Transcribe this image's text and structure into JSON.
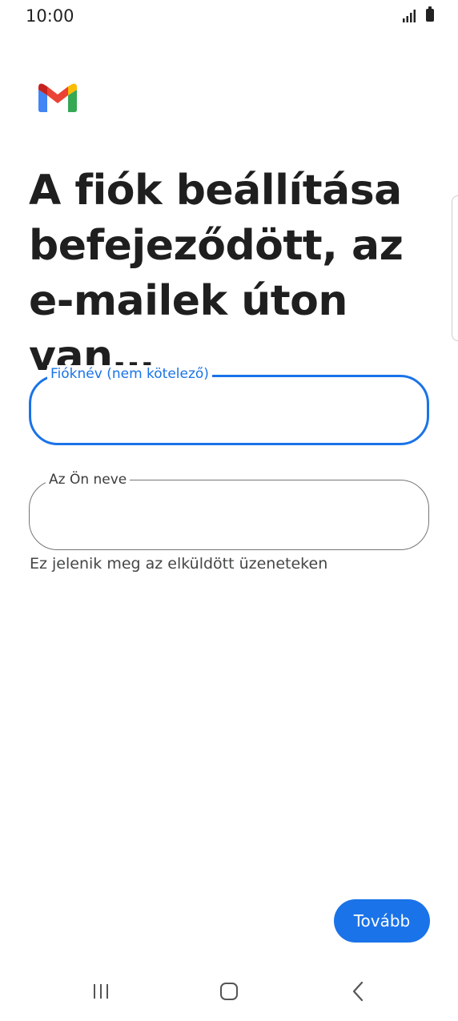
{
  "status_bar": {
    "time": "10:00",
    "icons": [
      "signal-icon",
      "battery-icon"
    ]
  },
  "app": {
    "logo": "gmail-logo-icon",
    "colors": {
      "blue": "#4285F4",
      "red": "#EA4335",
      "yellow": "#FBBC04",
      "green": "#34A853",
      "dark_red": "#C5221F"
    }
  },
  "headline": "A fiók beállítása befejeződött, az e-mailek úton van…",
  "form": {
    "account_name": {
      "label": "Fióknév (nem kötelező)",
      "value": ""
    },
    "your_name": {
      "label": "Az Ön neve",
      "value": "",
      "helper": "Ez jelenik meg az elküldött üzeneteken"
    }
  },
  "actions": {
    "next_label": "Tovább"
  },
  "theme": {
    "accent": "#1a73e8",
    "outline": "#757575"
  },
  "nav_bar": {
    "icons": [
      "recent-apps-icon",
      "home-icon",
      "back-icon"
    ]
  }
}
